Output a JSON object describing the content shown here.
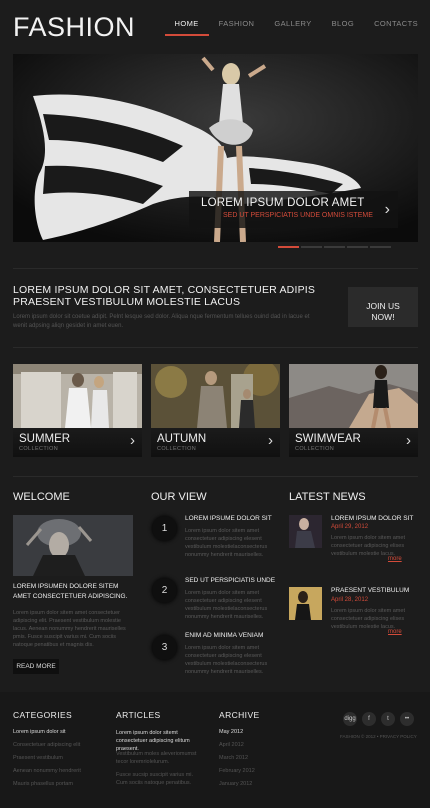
{
  "header": {
    "logo": "FASHION",
    "nav": [
      "HOME",
      "FASHION",
      "GALLERY",
      "BLOG",
      "CONTACTS"
    ],
    "active": "HOME"
  },
  "slider": {
    "title": "LOREM IPSUM DOLOR AMET",
    "subtitle": "SED UT PERSPICIATIS UNDE OMNIS ISTEME",
    "slide_count": 5,
    "active_slide": 1
  },
  "promo": {
    "title": "LOREM IPSUM DOLOR SIT AMET, CONSECTETUER ADIPIS PRAESENT VESTIBULUM MOLESTIE LACUS",
    "text": "Lorem ipsum dolor sit coetue adipit. Pelnt lesque sed dolor. Aliqua nque fermentum tellues  ouind dad in lacue et wenit adpsing aliqn gesidet in amet euen.",
    "button": "JOIN US\nNOW!"
  },
  "collections": [
    {
      "title": "SUMMER",
      "sub": "COLLECTION"
    },
    {
      "title": "AUTUMN",
      "sub": "COLLECTION"
    },
    {
      "title": "SWIMWEAR",
      "sub": "COLLECTION"
    }
  ],
  "welcome": {
    "heading": "WELCOME",
    "title": "LOREM IPSUMEN DOLORE SITEM AMET CONSECTETUER ADIPISCING.",
    "text": "Lorem ipsum dolor sitem amet consectetuer adipiscing elit. Praesent vestibulum molestie lacus. Aenean nonummy hendrerit mauriselles pmis. Fusce suscipit varius mi. Cum sociis natoque penatibus et magnis dis.",
    "button": "READ MORE"
  },
  "our_view": {
    "heading": "OUR VIEW",
    "items": [
      {
        "num": "1",
        "title": "LOREM IPSUME DOLOR SIT",
        "text": "Lorem ipsum dolor sitem amet consectetuer adipiscing elesent vestibulum molestielaconsecterus nonummy hendrerit mauriselles."
      },
      {
        "num": "2",
        "title": "SED UT PERSPICIATIS UNDE",
        "text": "Lorem ipsum dolor sitem amet consectetuer adipiscing elesent vestibulum molestielaconsecterus nonummy hendrerit mauriselles."
      },
      {
        "num": "3",
        "title": "ENIM AD MINIMA VENIAM",
        "text": "Lorem ipsum dolor sitem amet consectetuer adipiscing elesent vestibulum molestielaconsecterus nonummy hendrerit mauriselles."
      }
    ]
  },
  "news": {
    "heading": "LATEST NEWS",
    "items": [
      {
        "title": "LOREM IPSUM DOLOR SIT",
        "date": "April 29, 2012",
        "text": "Lorem ipsum dolor sitem amet consectetuer adipiscing elises vestibulum molestie lacus.",
        "more": "more"
      },
      {
        "title": "PRAESENT VESTIBULUM",
        "date": "April 28, 2012",
        "text": "Lorem ipsum dolor sitem amet consectetuer adipiscing elises vestibulum molestie lacus.",
        "more": "more"
      }
    ]
  },
  "footer": {
    "categories": {
      "heading": "CATEGORIES",
      "items": [
        "Lorem ipsum dolor sit",
        "Consectetuer adipiscing elit",
        "Praesent vestibulum",
        "Aenean nonummy hendrerit",
        "Mauris phasellus portam"
      ]
    },
    "articles": {
      "heading": "ARTICLES",
      "items": [
        "Lorem ipsum dolor sitemt consectetuer adipiscing elitum praesent.",
        "Vestibulum moles aleveriomumst tecor loremriolelurum.",
        "Fusce sucsip suscipit varius mi. Cum sociis natoque penatibus."
      ]
    },
    "archive": {
      "heading": "ARCHIVE",
      "items": [
        "May 2012",
        "April 2012",
        "March 2012",
        "February 2012",
        "January 2012"
      ]
    },
    "social": [
      "digg",
      "f",
      "t",
      "••"
    ],
    "copyright": "FASHION © 2012 • PRIVACY POLICY"
  },
  "colors": {
    "accent": "#d34b3a",
    "background": "#1c1c1c"
  }
}
